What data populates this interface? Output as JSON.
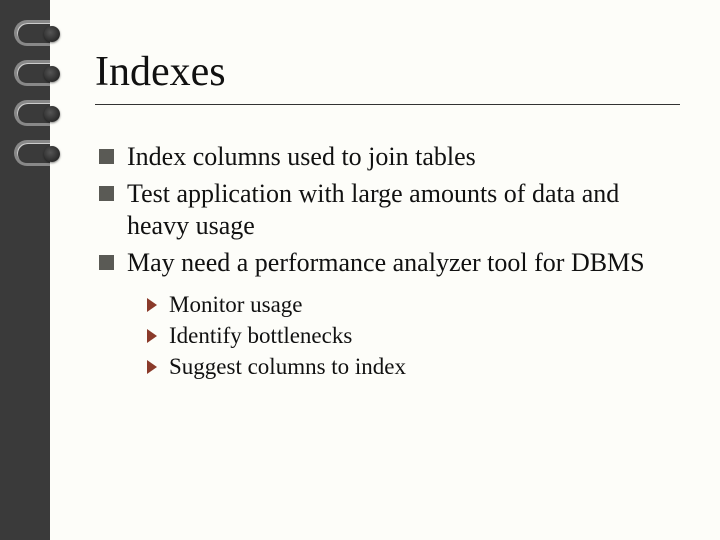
{
  "title": "Indexes",
  "bullets": [
    "Index columns used to join tables",
    "Test application with large amounts of data and heavy usage",
    "May need a performance analyzer tool for DBMS"
  ],
  "sub_bullets": [
    "Monitor usage",
    "Identify bottlenecks",
    "Suggest columns to index"
  ]
}
